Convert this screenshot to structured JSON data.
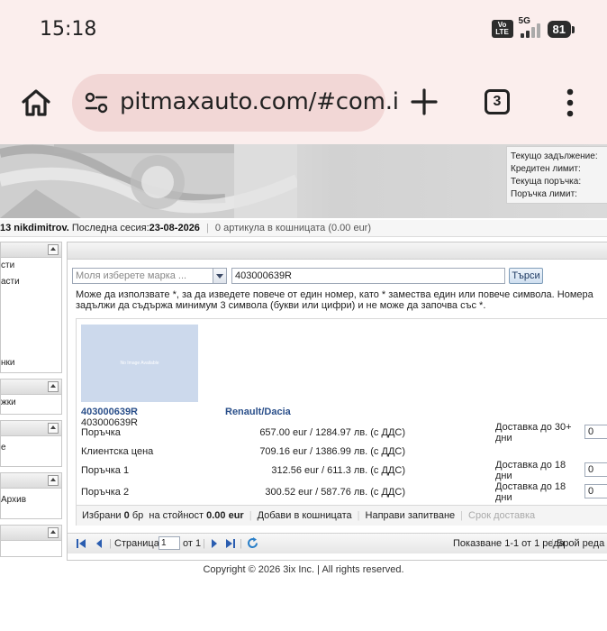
{
  "status": {
    "time": "15:18",
    "network": "5G",
    "volte": "Vo LTE",
    "battery": "81"
  },
  "browser": {
    "url": "pitmaxauto.com/#com.i",
    "tab_count": "3"
  },
  "account": {
    "labels": [
      "Текущо задължение:",
      "Кредитен лимит:",
      "Текуща поръчка:",
      "Поръчка лимит:"
    ]
  },
  "userline": {
    "user": "13 nikdimitrov.",
    "session_label": "Последна сесия:",
    "session_date": "23-08-2026",
    "cart": "0 артикула в кошницата (0.00 eur)"
  },
  "sidebar": {
    "panel1": [
      "сти",
      "асти",
      "нки"
    ],
    "panel2": [
      "жки"
    ],
    "panel3": [
      "е"
    ],
    "panel4": [
      "Архив"
    ]
  },
  "search": {
    "brand_placeholder": "Моля изберете марка ...",
    "query": "403000639R",
    "button": "Търси",
    "hint": "Може да използвате *, за да изведете повече от един номер, като * замества един или повече символа. Номера задължи да съдържа минимум 3 символа (букви или цифри) и не може да започва със *."
  },
  "result": {
    "thumb_text": "No Image Available",
    "part_number": "403000639R",
    "part_code": "403000639R",
    "brand": "Renault/Dacia",
    "rows": [
      {
        "label": "Поръчка",
        "price": "657.00 eur / 1284.97 лв. (с ДДС)",
        "delivery": "Доставка до 30+ дни",
        "qty": "0"
      },
      {
        "label": "Клиентска цена",
        "price": "709.16 eur / 1386.99 лв. (с ДДС)",
        "delivery": "",
        "qty": ""
      },
      {
        "label": "Поръчка 1",
        "price": "312.56 eur / 611.3 лв. (с ДДС)",
        "delivery": "Доставка до 18 дни",
        "qty": "0"
      },
      {
        "label": "Поръчка 2",
        "price": "300.52 eur / 587.76 лв. (с ДДС)",
        "delivery": "Доставка до 18 дни",
        "qty": "0"
      }
    ],
    "footer": {
      "selected_label": "Избрани",
      "selected_count": "0",
      "count_unit": "бр",
      "value_label": "на стойност",
      "value": "0.00 eur",
      "add_to_cart": "Добави в кошницата",
      "inquiry": "Направи запитване",
      "delivery_term": "Срок доставка"
    }
  },
  "pager": {
    "page_label": "Страница",
    "page": "1",
    "of": "от 1",
    "showing": "Показване 1-1 от 1 реда",
    "rows_per_page": "Брой реда на"
  },
  "copyright": "Copyright © 2026 3ix Inc. | All rights reserved.",
  "colors": {
    "link": "#2a4f8a",
    "chrome_bg": "#fbeeed",
    "url_bg": "#f2d7d6"
  }
}
